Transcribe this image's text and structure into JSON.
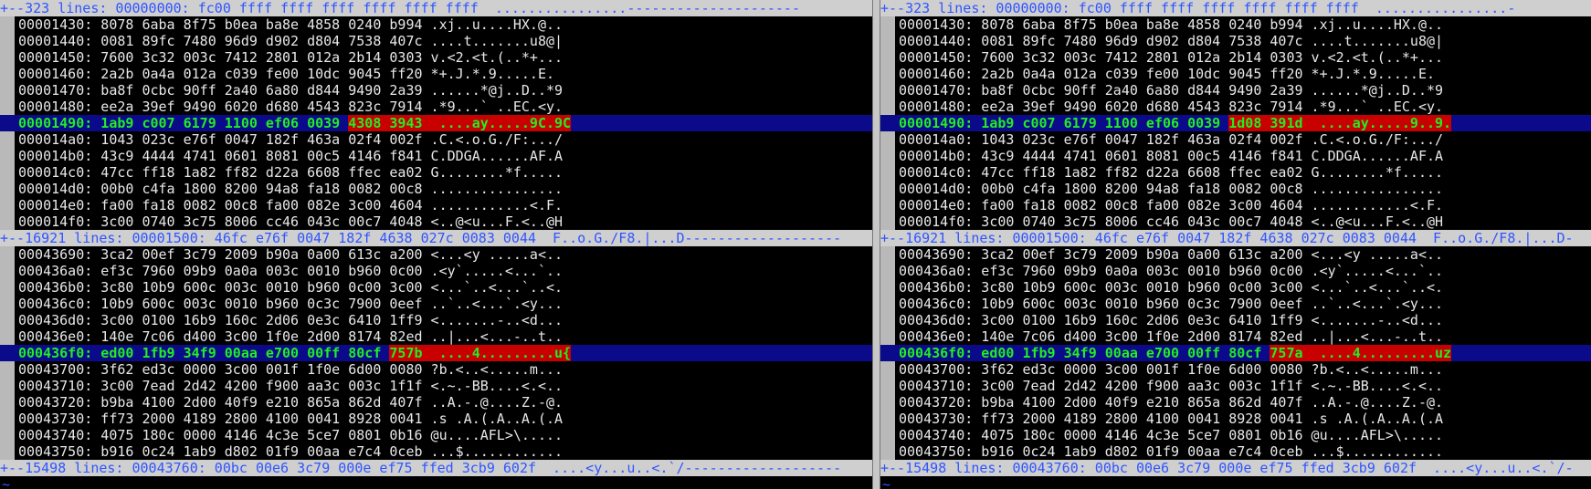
{
  "left": {
    "fold_top": "+--323 lines: 00000000: fc00 ffff ffff ffff ffff ffff ffff  ................---------------------",
    "block1": [
      "00001430: 8078 6aba 8f75 b0ea ba8e 4858 0240 b994  .xj..u....HX.@..",
      "00001440: 0081 89fc 7480 96d9 d902 d804 7538 407c  ....t.......u8@|",
      "00001450: 7600 3c32 003c 7412 2801 012a 2b14 0303  v.<2.<t.(..*+...",
      "00001460: 2a2b 0a4a 012a c039 fe00 10dc 9045 ff20  *+.J.*.9.....E. ",
      "00001470: ba8f 0cbc 90ff 2a40 6a80 d844 9490 2a39  ......*@j..D..*9",
      "00001480: ee2a 39ef 9490 6020 d680 4543 823c 7914  .*9...` ..EC.<y."
    ],
    "diff1": {
      "pre": "00001490: 1ab9 c007 6179 1100 ef06 0039 ",
      "hex_changed": "4308 3943",
      "gap": "  ",
      "ascii_pre": "....ay.....",
      "ascii_changed": "9C.9C"
    },
    "block1b": [
      "000014a0: 1043 023c e76f 0047 182f 463a 02f4 002f  .C.<.o.G./F:.../",
      "000014b0: 43c9 4444 4741 0601 8081 00c5 4146 f841  C.DDGA......AF.A",
      "000014c0: 47cc ff18 1a82 ff82 d22a 6608 ffec ea02  G........*f.....",
      "000014d0: 00b0 c4fa 1800 8200 94a8 fa18 0082 00c8  ................",
      "000014e0: fa00 fa18 0082 00c8 fa00 082e 3c00 4604  ............<.F.",
      "000014f0: 3c00 0740 3c75 8006 cc46 043c 00c7 4048  <..@<u...F.<..@H"
    ],
    "fold_mid": "+--16921 lines: 00001500: 46fc e76f 0047 182f 4638 027c 0083 0044  F..o.G./F8.|...D-------------------",
    "block2": [
      "00043690: 3ca2 00ef 3c79 2009 b90a 0a00 613c a200  <...<y .....a<..",
      "000436a0: ef3c 7960 09b9 0a0a 003c 0010 b960 0c00  .<y`.....<...`..",
      "000436b0: 3c80 10b9 600c 003c 0010 b960 0c00 3c00  <...`..<...`..<.",
      "000436c0: 10b9 600c 003c 0010 b960 0c3c 7900 0eef  ..`..<...`.<y...",
      "000436d0: 3c00 0100 16b9 160c 2d06 0e3c 6410 1ff9  <.......-..<d...",
      "000436e0: 140e 7c06 d400 3c00 1f0e 2d00 8174 82ed  ..|...<...-..t.."
    ],
    "diff2": {
      "pre": "000436f0: ed00 1fb9 34f9 00aa e700 00ff 80cf ",
      "hex_changed": "757b",
      "gap": "  ",
      "ascii_pre": "....4.........",
      "ascii_changed": "u{"
    },
    "block2b": [
      "00043700: 3f62 ed3c 0000 3c00 001f 1f0e 6d00 0080  ?b.<..<.....m...",
      "00043710: 3c00 7ead 2d42 4200 f900 aa3c 003c 1f1f  <.~.-BB....<.<..",
      "00043720: b9ba 4100 2d00 40f9 e210 865a 862d 407f  ..A.-.@....Z.-@.",
      "00043730: ff73 2000 4189 2800 4100 0041 8928 0041  .s .A.(.A..A.(.A",
      "00043740: 4075 180c 0000 4146 4c3e 5ce7 0801 0b16  @u....AFL>\\.....",
      "00043750: b916 0c24 1ab9 d802 01f9 00aa e7c4 0ceb  ...$............"
    ],
    "fold_bottom": "+--15498 lines: 00043760: 00bc 00e6 3c79 000e ef75 ffed 3cb9 602f  ....<y...u..<.`/-------------------"
  },
  "right": {
    "fold_top": "+--323 lines: 00000000: fc00 ffff ffff ffff ffff ffff ffff  ................-",
    "block1": [
      "00001430: 8078 6aba 8f75 b0ea ba8e 4858 0240 b994  .xj..u....HX.@..",
      "00001440: 0081 89fc 7480 96d9 d902 d804 7538 407c  ....t.......u8@|",
      "00001450: 7600 3c32 003c 7412 2801 012a 2b14 0303  v.<2.<t.(..*+...",
      "00001460: 2a2b 0a4a 012a c039 fe00 10dc 9045 ff20  *+.J.*.9.....E. ",
      "00001470: ba8f 0cbc 90ff 2a40 6a80 d844 9490 2a39  ......*@j..D..*9",
      "00001480: ee2a 39ef 9490 6020 d680 4543 823c 7914  .*9...` ..EC.<y."
    ],
    "diff1": {
      "pre": "00001490: 1ab9 c007 6179 1100 ef06 0039 ",
      "hex_changed": "1d08 391d",
      "gap": "  ",
      "ascii_pre": "....ay.....",
      "ascii_changed": "9..9."
    },
    "block1b": [
      "000014a0: 1043 023c e76f 0047 182f 463a 02f4 002f  .C.<.o.G./F:.../",
      "000014b0: 43c9 4444 4741 0601 8081 00c5 4146 f841  C.DDGA......AF.A",
      "000014c0: 47cc ff18 1a82 ff82 d22a 6608 ffec ea02  G........*f.....",
      "000014d0: 00b0 c4fa 1800 8200 94a8 fa18 0082 00c8  ................",
      "000014e0: fa00 fa18 0082 00c8 fa00 082e 3c00 4604  ............<.F.",
      "000014f0: 3c00 0740 3c75 8006 cc46 043c 00c7 4048  <..@<u...F.<..@H"
    ],
    "fold_mid": "+--16921 lines: 00001500: 46fc e76f 0047 182f 4638 027c 0083 0044  F..o.G./F8.|...D-",
    "block2": [
      "00043690: 3ca2 00ef 3c79 2009 b90a 0a00 613c a200  <...<y .....a<..",
      "000436a0: ef3c 7960 09b9 0a0a 003c 0010 b960 0c00  .<y`.....<...`..",
      "000436b0: 3c80 10b9 600c 003c 0010 b960 0c00 3c00  <...`..<...`..<.",
      "000436c0: 10b9 600c 003c 0010 b960 0c3c 7900 0eef  ..`..<...`.<y...",
      "000436d0: 3c00 0100 16b9 160c 2d06 0e3c 6410 1ff9  <.......-..<d...",
      "000436e0: 140e 7c06 d400 3c00 1f0e 2d00 8174 82ed  ..|...<...-..t.."
    ],
    "diff2": {
      "pre": "000436f0: ed00 1fb9 34f9 00aa e700 00ff 80cf ",
      "hex_changed": "757a",
      "gap": "  ",
      "ascii_pre": "....4.........",
      "ascii_changed": "uz"
    },
    "block2b": [
      "00043700: 3f62 ed3c 0000 3c00 001f 1f0e 6d00 0080  ?b.<..<.....m...",
      "00043710: 3c00 7ead 2d42 4200 f900 aa3c 003c 1f1f  <.~.-BB....<.<..",
      "00043720: b9ba 4100 2d00 40f9 e210 865a 862d 407f  ..A.-.@....Z.-@.",
      "00043730: ff73 2000 4189 2800 4100 0041 8928 0041  .s .A.(.A..A.(.A",
      "00043740: 4075 180c 0000 4146 4c3e 5ce7 0801 0b16  @u....AFL>\\.....",
      "00043750: b916 0c24 1ab9 d802 01f9 00aa e7c4 0ceb  ...$............"
    ],
    "fold_bottom": "+--15498 lines: 00043760: 00bc 00e6 3c79 000e ef75 ffed 3cb9 602f  ....<y...u..<.`/-"
  },
  "tilde": "~",
  "colors": {
    "diff_row_bg": "#0a0a8a",
    "changed_bg": "#c80000",
    "diff_text": "#22ee22",
    "fold_text": "#2f55ff",
    "fold_bg": "#cfcfcf",
    "gutter_bg": "#b9b9b9"
  }
}
